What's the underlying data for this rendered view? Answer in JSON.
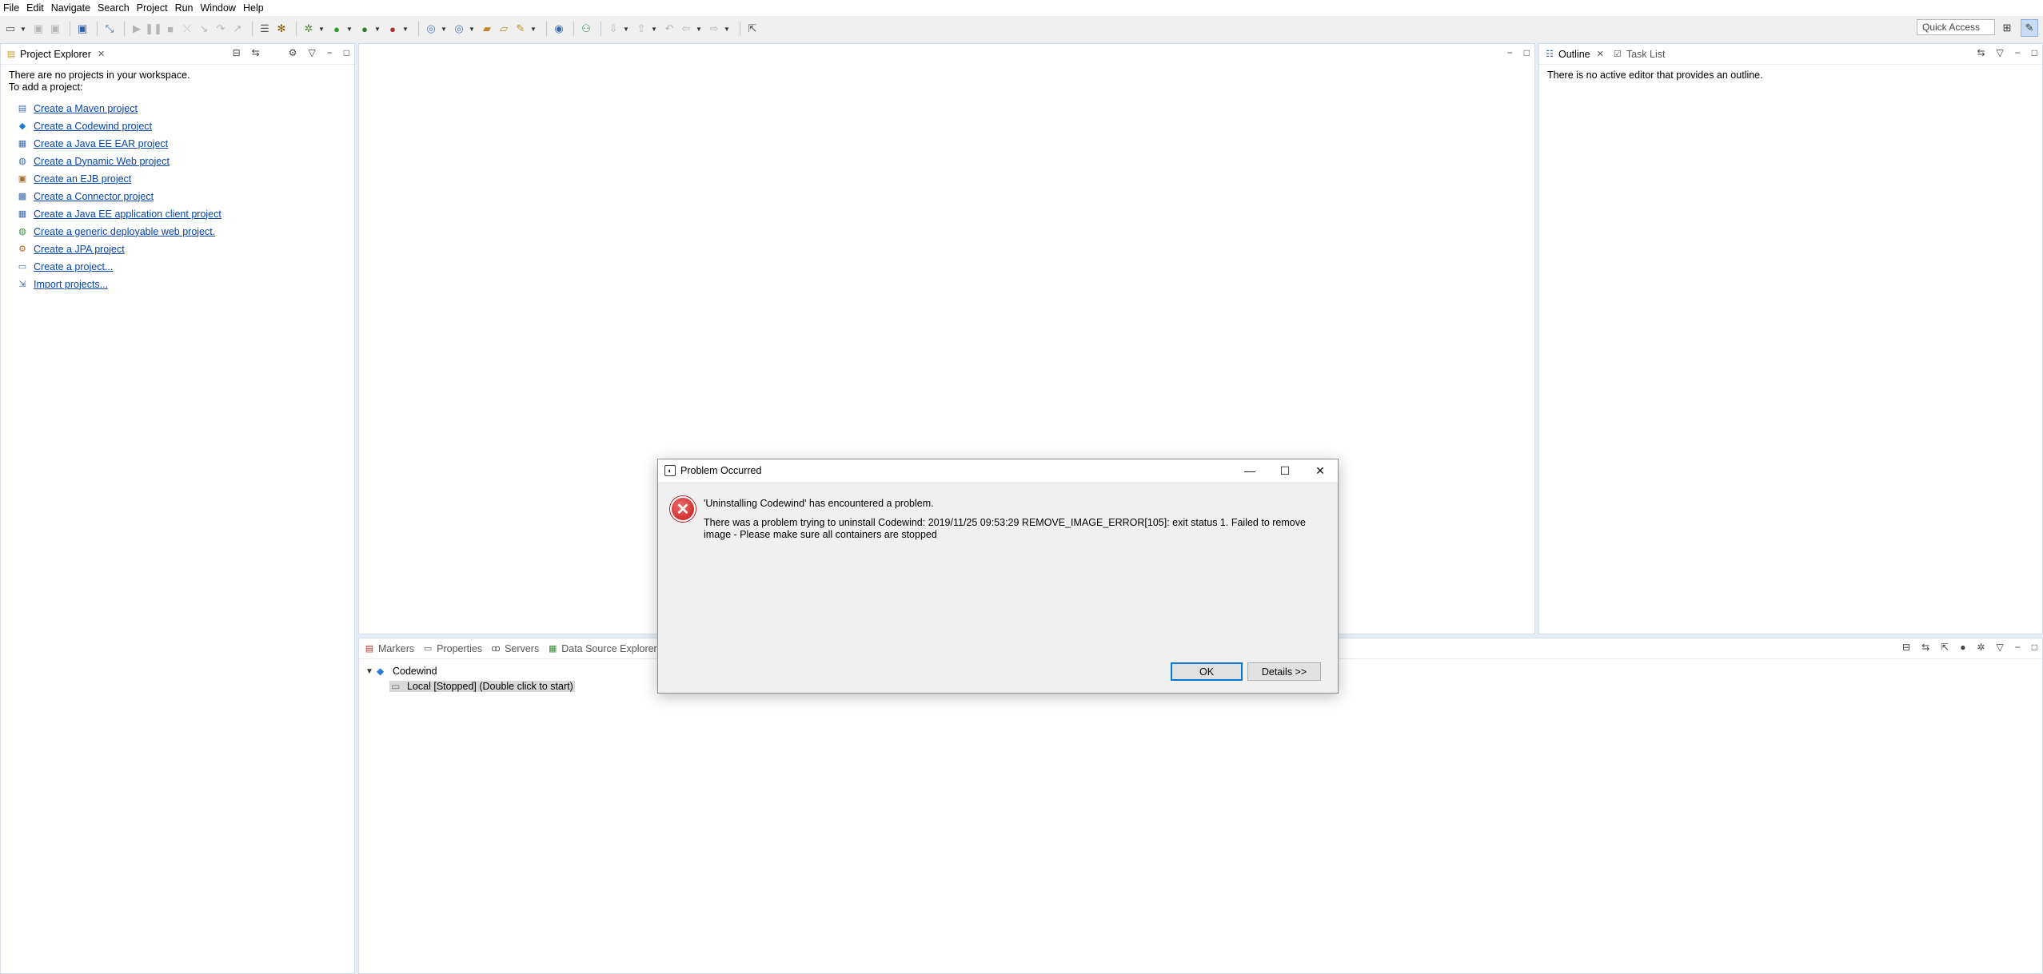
{
  "menu": [
    "File",
    "Edit",
    "Navigate",
    "Search",
    "Project",
    "Run",
    "Window",
    "Help"
  ],
  "toolbar": {
    "quick_access_placeholder": "Quick Access"
  },
  "project_explorer": {
    "tab_label": "Project Explorer",
    "intro_line1": "There are no projects in your workspace.",
    "intro_line2": "To add a project:",
    "links": [
      {
        "label": "Create a Maven project",
        "icon": "maven-icon"
      },
      {
        "label": "Create a Codewind project",
        "icon": "codewind-icon"
      },
      {
        "label": "Create a Java EE EAR project",
        "icon": "ear-project-icon"
      },
      {
        "label": "Create a Dynamic Web project",
        "icon": "web-project-icon"
      },
      {
        "label": "Create an EJB project",
        "icon": "ejb-project-icon"
      },
      {
        "label": "Create a Connector project",
        "icon": "connector-project-icon"
      },
      {
        "label": "Create a Java EE application client project",
        "icon": "app-client-icon"
      },
      {
        "label": "Create a generic deployable web project.",
        "icon": "web-deploy-icon"
      },
      {
        "label": "Create a JPA project",
        "icon": "jpa-project-icon"
      },
      {
        "label": "Create a project...",
        "icon": "new-project-icon"
      },
      {
        "label": "Import projects...",
        "icon": "import-icon"
      }
    ]
  },
  "outline": {
    "tab_label": "Outline",
    "task_list_label": "Task List",
    "empty_text": "There is no active editor that provides an outline."
  },
  "bottom": {
    "tabs": [
      "Markers",
      "Properties",
      "Servers",
      "Data Source Explorer"
    ],
    "tree_root": "Codewind",
    "tree_child": "Local [Stopped] (Double click to start)"
  },
  "dialog": {
    "title": "Problem Occurred",
    "headline": "'Uninstalling Codewind' has encountered a problem.",
    "message": "There was a problem trying to uninstall Codewind: 2019/11/25 09:53:29 REMOVE_IMAGE_ERROR[105]: exit status 1. Failed to remove image - Please make sure all containers are stopped",
    "ok_label": "OK",
    "details_label": "Details >>"
  }
}
